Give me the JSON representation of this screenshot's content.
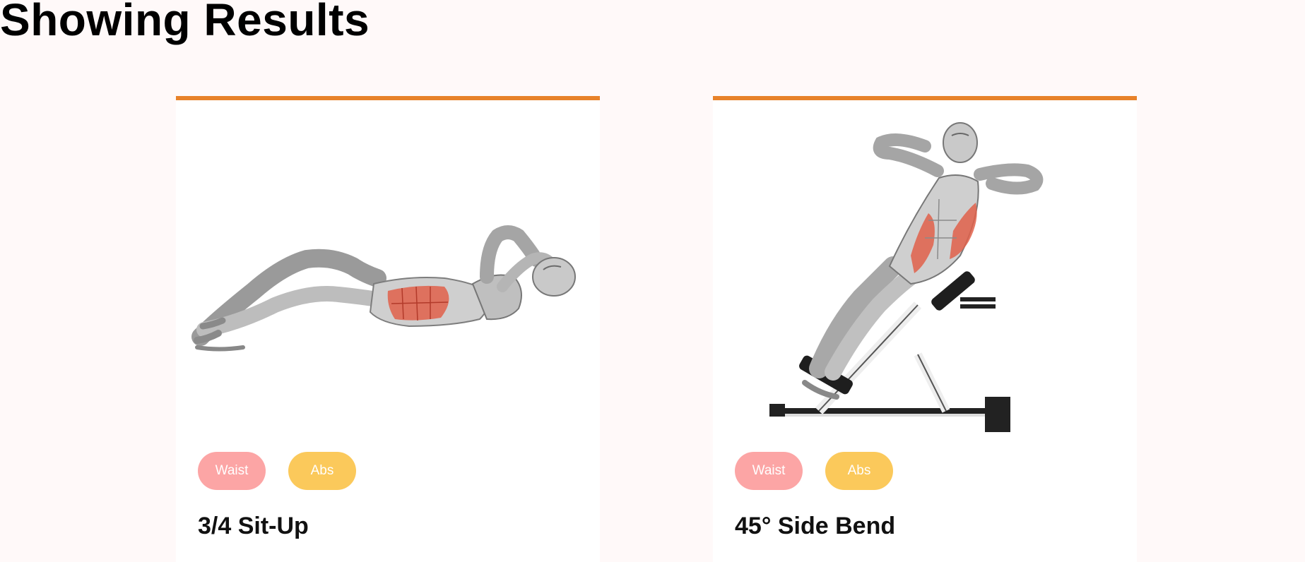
{
  "page": {
    "title": "Showing Results"
  },
  "colors": {
    "accent_border": "#e8822a",
    "tag_waist": "#fca5a5",
    "tag_abs": "#fbc95b",
    "target_muscle": "#e0604a"
  },
  "results": [
    {
      "name": "3/4 Sit-Up",
      "tags": [
        "Waist",
        "Abs"
      ]
    },
    {
      "name": "45° Side Bend",
      "tags": [
        "Waist",
        "Abs"
      ]
    }
  ]
}
